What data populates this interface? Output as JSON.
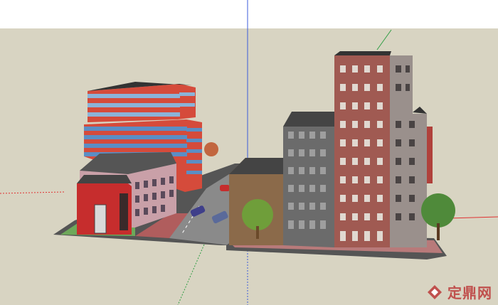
{
  "viewport": {
    "sky_color": "#ffffff",
    "ground_color": "#d8d4c2",
    "axes": {
      "blue": "#3b5bdb",
      "red": "#e03131",
      "green": "#2f9e44"
    }
  },
  "scene": {
    "description_visible": false
  },
  "watermark": {
    "text": "定鼎网",
    "logo_icon": "diamond-house-icon",
    "color": "#c0504d"
  }
}
